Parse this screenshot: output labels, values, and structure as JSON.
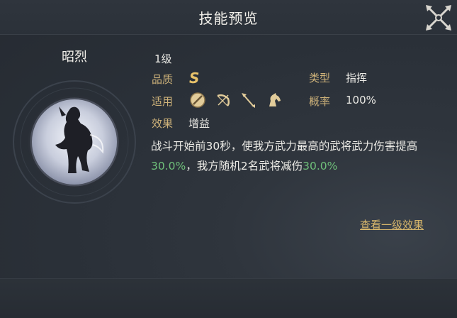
{
  "window": {
    "title": "技能预览"
  },
  "hero": {
    "name": "昭烈"
  },
  "skill": {
    "level": "1级",
    "quality_label": "品质",
    "quality_value": "S",
    "type_label": "类型",
    "type_value": "指挥",
    "apply_label": "适用",
    "apply_icons": [
      "shield-icon",
      "bow-icon",
      "spear-icon",
      "horse-icon"
    ],
    "rate_label": "概率",
    "rate_value": "100%",
    "effect_label": "效果",
    "effect_value": "增益",
    "desc_part1": "战斗开始前30秒，使我方武力最高的武将武力伤害提高",
    "desc_hl1": "30.0%",
    "desc_part2": "，我方随机2名武将减伤",
    "desc_hl2": "30.0%"
  },
  "actions": {
    "view_level1": "查看一级效果"
  },
  "colors": {
    "label": "#cfb37a",
    "highlight": "#6fc07a",
    "link": "#d6b56b"
  }
}
